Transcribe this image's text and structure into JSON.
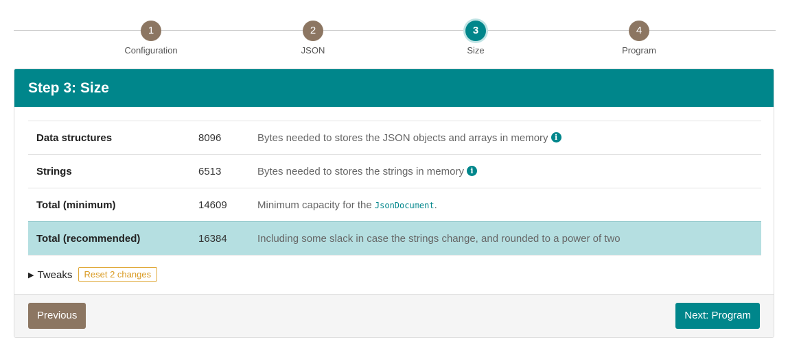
{
  "stepper": {
    "steps": [
      {
        "number": "1",
        "label": "Configuration"
      },
      {
        "number": "2",
        "label": "JSON"
      },
      {
        "number": "3",
        "label": "Size"
      },
      {
        "number": "4",
        "label": "Program"
      }
    ],
    "active_step": "3"
  },
  "card": {
    "title": "Step 3: Size"
  },
  "sizes": {
    "rows": [
      {
        "name": "Data structures",
        "value": "8096",
        "description": "Bytes needed to stores the JSON objects and arrays in memory"
      },
      {
        "name": "Strings",
        "value": "6513",
        "description": "Bytes needed to stores the strings in memory"
      },
      {
        "name": "Total (minimum)",
        "value": "14609",
        "description_prefix": "Minimum capacity for the ",
        "description_code": "JsonDocument",
        "description_suffix": "."
      },
      {
        "name": "Total (recommended)",
        "value": "16384",
        "description": "Including some slack in case the strings change, and rounded to a power of two"
      }
    ]
  },
  "tweaks": {
    "label": "Tweaks",
    "reset_label": "Reset 2 changes"
  },
  "footer": {
    "previous_label": "Previous",
    "next_label": "Next: Program"
  },
  "icons": {
    "info": "info-circle-icon",
    "tweaks_toggle": "triangle-right-icon"
  },
  "colors": {
    "accent": "#00868b",
    "step_inactive": "#8c7662",
    "highlight_row": "#b5dfe1",
    "reset_border": "#e0a93a"
  }
}
